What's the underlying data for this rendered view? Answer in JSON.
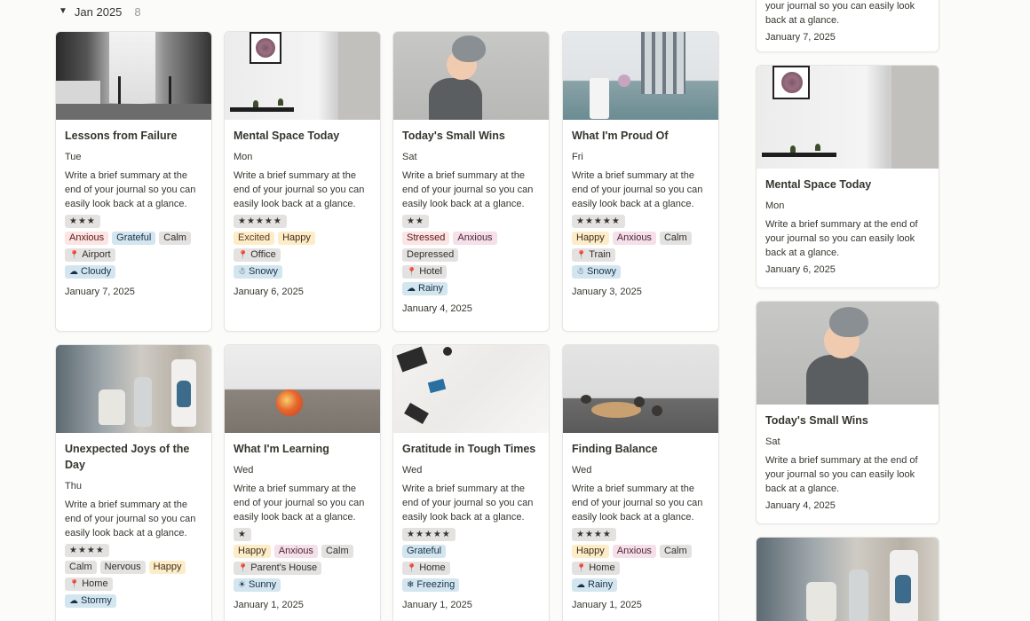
{
  "group": {
    "toggle_icon": "▼",
    "title": "Jan 2025",
    "count": "8"
  },
  "summary_text": "Write a brief summary at the end of your journal so you can easily look back at a glance.",
  "grid_cards": [
    {
      "title": "Lessons from Failure",
      "day": "Tue",
      "rating": "★★★",
      "moods": [
        {
          "label": "Anxious",
          "color": "red"
        },
        {
          "label": "Grateful",
          "color": "blue"
        },
        {
          "label": "Calm",
          "color": "gray"
        }
      ],
      "location": "Airport",
      "weather": {
        "icon": "☁",
        "label": "Cloudy"
      },
      "date": "January 7, 2025"
    },
    {
      "title": "Mental Space Today",
      "day": "Mon",
      "rating": "★★★★★",
      "moods": [
        {
          "label": "Excited",
          "color": "orange"
        },
        {
          "label": "Happy",
          "color": "yellow"
        }
      ],
      "location": "Office",
      "weather": {
        "icon": "☃",
        "label": "Snowy"
      },
      "date": "January 6, 2025"
    },
    {
      "title": "Today's Small Wins",
      "day": "Sat",
      "rating": "★★",
      "moods": [
        {
          "label": "Stressed",
          "color": "red"
        },
        {
          "label": "Anxious",
          "color": "pink"
        },
        {
          "label": "Depressed",
          "color": "gray"
        }
      ],
      "location": "Hotel",
      "weather": {
        "icon": "☁",
        "label": "Rainy"
      },
      "date": "January 4, 2025"
    },
    {
      "title": "What I'm Proud Of",
      "day": "Fri",
      "rating": "★★★★★",
      "moods": [
        {
          "label": "Happy",
          "color": "yellow"
        },
        {
          "label": "Anxious",
          "color": "pink"
        },
        {
          "label": "Calm",
          "color": "gray"
        }
      ],
      "location": "Train",
      "weather": {
        "icon": "☃",
        "label": "Snowy"
      },
      "date": "January 3, 2025"
    },
    {
      "title": "Unexpected Joys of the Day",
      "day": "Thu",
      "rating": "★★★★",
      "moods": [
        {
          "label": "Calm",
          "color": "gray"
        },
        {
          "label": "Nervous",
          "color": "gray"
        },
        {
          "label": "Happy",
          "color": "yellow"
        }
      ],
      "location": "Home",
      "weather": {
        "icon": "☁",
        "label": "Stormy"
      },
      "date": "January 1, 2025"
    },
    {
      "title": "What I'm Learning",
      "day": "Wed",
      "rating": "★",
      "moods": [
        {
          "label": "Happy",
          "color": "yellow"
        },
        {
          "label": "Anxious",
          "color": "pink"
        },
        {
          "label": "Calm",
          "color": "gray"
        }
      ],
      "location": "Parent's House",
      "weather": {
        "icon": "☀",
        "label": "Sunny"
      },
      "date": "January 1, 2025"
    },
    {
      "title": "Gratitude in Tough Times",
      "day": "Wed",
      "rating": "★★★★★",
      "moods": [
        {
          "label": "Grateful",
          "color": "blue"
        }
      ],
      "location": "Home",
      "weather": {
        "icon": "❄",
        "label": "Freezing"
      },
      "date": "January 1, 2025"
    },
    {
      "title": "Finding Balance",
      "day": "Wed",
      "rating": "★★★★",
      "moods": [
        {
          "label": "Happy",
          "color": "yellow"
        },
        {
          "label": "Anxious",
          "color": "pink"
        },
        {
          "label": "Calm",
          "color": "gray"
        }
      ],
      "location": "Home",
      "weather": {
        "icon": "☁",
        "label": "Rainy"
      },
      "date": "January 1, 2025"
    }
  ],
  "side_cards": [
    {
      "summary_tail": "your journal so you can easily look back at a glance.",
      "date": "January 7, 2025"
    },
    {
      "title": "Mental Space Today",
      "day": "Mon",
      "date": "January 6, 2025"
    },
    {
      "title": "Today's Small Wins",
      "day": "Sat",
      "date": "January 4, 2025"
    }
  ]
}
